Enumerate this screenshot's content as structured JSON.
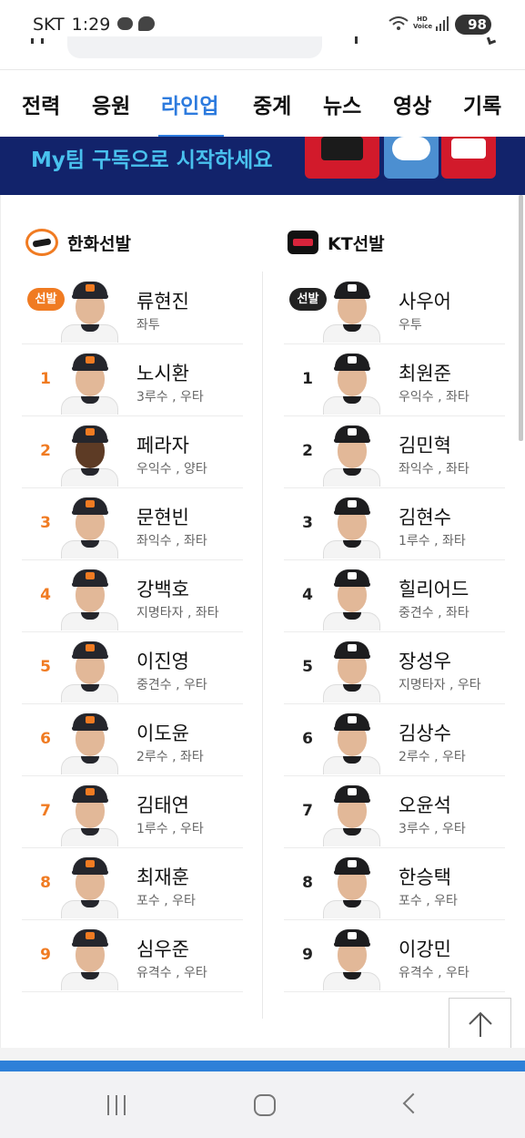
{
  "status_bar": {
    "carrier": "SKT",
    "time": "1:29",
    "battery": "98",
    "hd_label": "HD Voice",
    "icons": [
      "talk-icon",
      "talk-bubble-icon",
      "wifi-icon",
      "hd-voice-icon",
      "signal-icon",
      "battery-icon"
    ]
  },
  "tabs": [
    {
      "label": "전력"
    },
    {
      "label": "응원"
    },
    {
      "label": "라인업"
    },
    {
      "label": "중계"
    },
    {
      "label": "뉴스"
    },
    {
      "label": "영상"
    },
    {
      "label": "기록"
    }
  ],
  "active_tab": "라인업",
  "banner": {
    "text": "My팀 구독으로 시작하세요"
  },
  "lineup": {
    "home": {
      "team_label": "한화선발",
      "logo": "eagles-logo",
      "accent": "#f07b22",
      "players": [
        {
          "order": "선발",
          "name": "류현진",
          "info": "좌투"
        },
        {
          "order": "1",
          "name": "노시환",
          "info": "3루수 , 우타"
        },
        {
          "order": "2",
          "name": "페라자",
          "info": "우익수 , 양타"
        },
        {
          "order": "3",
          "name": "문현빈",
          "info": "좌익수 , 좌타"
        },
        {
          "order": "4",
          "name": "강백호",
          "info": "지명타자 , 좌타"
        },
        {
          "order": "5",
          "name": "이진영",
          "info": "중견수 , 우타"
        },
        {
          "order": "6",
          "name": "이도윤",
          "info": "2루수 , 좌타"
        },
        {
          "order": "7",
          "name": "김태연",
          "info": "1루수 , 우타"
        },
        {
          "order": "8",
          "name": "최재훈",
          "info": "포수 , 우타"
        },
        {
          "order": "9",
          "name": "심우준",
          "info": "유격수 , 우타"
        }
      ]
    },
    "away": {
      "team_label": "KT선발",
      "logo": "ktwiz-logo",
      "accent": "#222222",
      "players": [
        {
          "order": "선발",
          "name": "사우어",
          "info": "우투"
        },
        {
          "order": "1",
          "name": "최원준",
          "info": "우익수 , 좌타"
        },
        {
          "order": "2",
          "name": "김민혁",
          "info": "좌익수 , 좌타"
        },
        {
          "order": "3",
          "name": "김현수",
          "info": "1루수 , 좌타"
        },
        {
          "order": "4",
          "name": "힐리어드",
          "info": "중견수 , 좌타"
        },
        {
          "order": "5",
          "name": "장성우",
          "info": "지명타자 , 우타"
        },
        {
          "order": "6",
          "name": "김상수",
          "info": "2루수 , 우타"
        },
        {
          "order": "7",
          "name": "오윤석",
          "info": "3루수 , 우타"
        },
        {
          "order": "8",
          "name": "한승택",
          "info": "포수 , 우타"
        },
        {
          "order": "9",
          "name": "이강민",
          "info": "유격수 , 우타"
        }
      ]
    }
  },
  "colors": {
    "active_tab": "#2d7bde",
    "banner_bg": "#12236b",
    "banner_text": "#49c1ee",
    "home_accent": "#f07b22",
    "away_accent": "#222222"
  }
}
